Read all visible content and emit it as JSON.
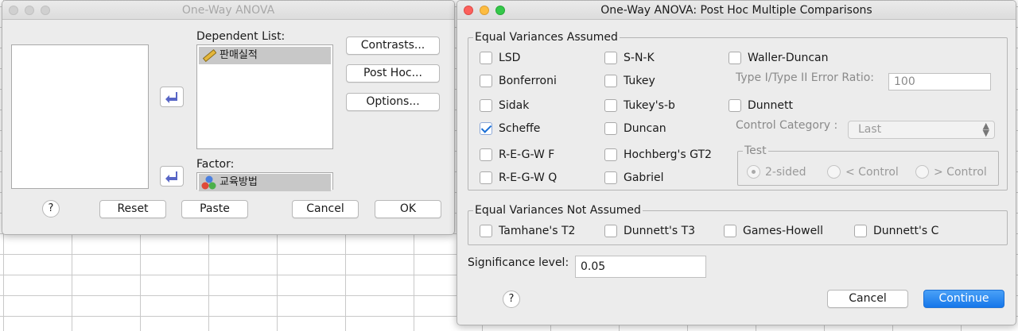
{
  "main_dialog": {
    "title": "One-Way ANOVA",
    "dependent_list_label": "Dependent List:",
    "dependent_item": "판매실적",
    "factor_label": "Factor:",
    "factor_item": "교육방법",
    "buttons": {
      "contrasts": "Contrasts...",
      "post_hoc": "Post Hoc...",
      "options": "Options...",
      "help": "?",
      "reset": "Reset",
      "paste": "Paste",
      "cancel": "Cancel",
      "ok": "OK"
    }
  },
  "posthoc_dialog": {
    "title": "One-Way ANOVA: Post Hoc Multiple Comparisons",
    "equal_assumed": {
      "title": "Equal Variances Assumed",
      "lsd": "LSD",
      "bonferroni": "Bonferroni",
      "sidak": "Sidak",
      "scheffe": "Scheffe",
      "regwf": "R-E-G-W F",
      "regwq": "R-E-G-W Q",
      "snk": "S-N-K",
      "tukey": "Tukey",
      "tukeyb": "Tukey's-b",
      "duncan": "Duncan",
      "hochberg": "Hochberg's GT2",
      "gabriel": "Gabriel",
      "waller": "Waller-Duncan",
      "ratio_label": "Type I/Type II Error Ratio:",
      "ratio_value": "100",
      "dunnett": "Dunnett",
      "control_label": "Control Category :",
      "control_value": "Last",
      "test_title": "Test",
      "two_sided": "2-sided",
      "lt_control": "< Control",
      "gt_control": "> Control"
    },
    "scheffe_checked": true,
    "not_assumed": {
      "title": "Equal Variances Not Assumed",
      "tamhane": "Tamhane's T2",
      "dunnett_t3": "Dunnett's T3",
      "games_howell": "Games-Howell",
      "dunnett_c": "Dunnett's C"
    },
    "significance_label": "Significance level:",
    "significance_value": "0.05",
    "help": "?",
    "cancel": "Cancel",
    "continue": "Continue"
  },
  "colors": {
    "accent": "#1677ea",
    "window_bg": "#ececec"
  }
}
